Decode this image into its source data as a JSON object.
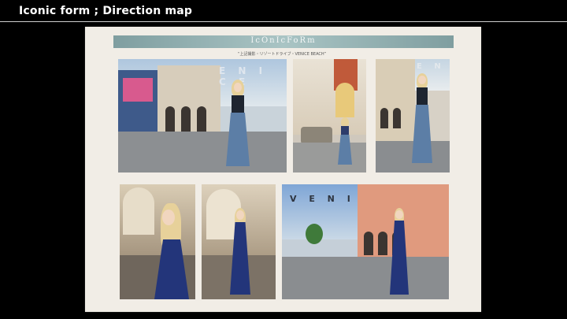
{
  "slide": {
    "title": "Iconic form ; Direction map"
  },
  "page": {
    "banner": "IcOnIcFoRm",
    "subtitle": "“上記撮影・リゾートドライブ・VENICE BEACH”"
  },
  "signs": {
    "venice_top": "E N I C E",
    "venice_right": "E N",
    "venice_bottom": "V E N I C"
  },
  "colors": {
    "background": "#000000",
    "paper": "#f1ede6",
    "banner": "#8fb0b1",
    "dress_blue": "#5c7ea6",
    "dress_navy": "#23357a"
  }
}
